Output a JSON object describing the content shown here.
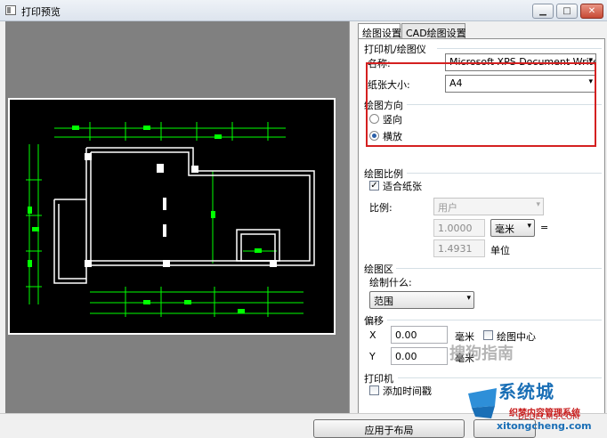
{
  "window": {
    "title": "打印预览",
    "controls": {
      "minimize": "▁",
      "maximize": "□",
      "close": "✕"
    }
  },
  "tabs": [
    {
      "label": "绘图设置",
      "active": true
    },
    {
      "label": "CAD绘图设置",
      "active": false
    }
  ],
  "printer_group": {
    "title": "打印机/绘图仪",
    "name_label": "名称:",
    "name_value": "Microsoft XPS Document Writer",
    "paper_label": "纸张大小:",
    "paper_value": "A4"
  },
  "orientation_group": {
    "title": "绘图方向",
    "portrait_label": "竖向",
    "landscape_label": "横放",
    "selected": "landscape"
  },
  "scale_group": {
    "title": "绘图比例",
    "fit_paper_label": "适合纸张",
    "fit_paper_checked": true,
    "checkmark": "✓",
    "preset_value": "用户",
    "ratio_label": "比例:",
    "ratio_value1": "1.0000",
    "unit_value": "毫米",
    "equals": "=",
    "ratio_value2": "1.4931",
    "unit_label": "单位"
  },
  "area_group": {
    "title": "绘图区",
    "what_label": "绘制什么:",
    "what_value": "范围"
  },
  "offset_group": {
    "title": "偏移",
    "x_label": "X",
    "x_value": "0.00",
    "x_unit": "毫米",
    "center_label": "绘图中心",
    "y_label": "Y",
    "y_value": "0.00",
    "y_unit": "毫米"
  },
  "printer2_group": {
    "title": "打印机",
    "timestamp_label": "添加时间戳"
  },
  "buttons": {
    "apply_label": "应用于布局"
  },
  "watermarks": {
    "sogou": "搜狗指南",
    "site_logo": "系统城",
    "site_cn": "织梦内容管理系统",
    "site_url": "DEDECMS.COM",
    "site2": "xitongcheng.com"
  },
  "colors": {
    "highlight_box": "#d42020",
    "drawing_background": "#000000",
    "drawing_lines": "#ffffff",
    "dimension_lines": "#00ff00",
    "preview_background": "#808080"
  },
  "icons": {
    "dropdown": "▾"
  }
}
